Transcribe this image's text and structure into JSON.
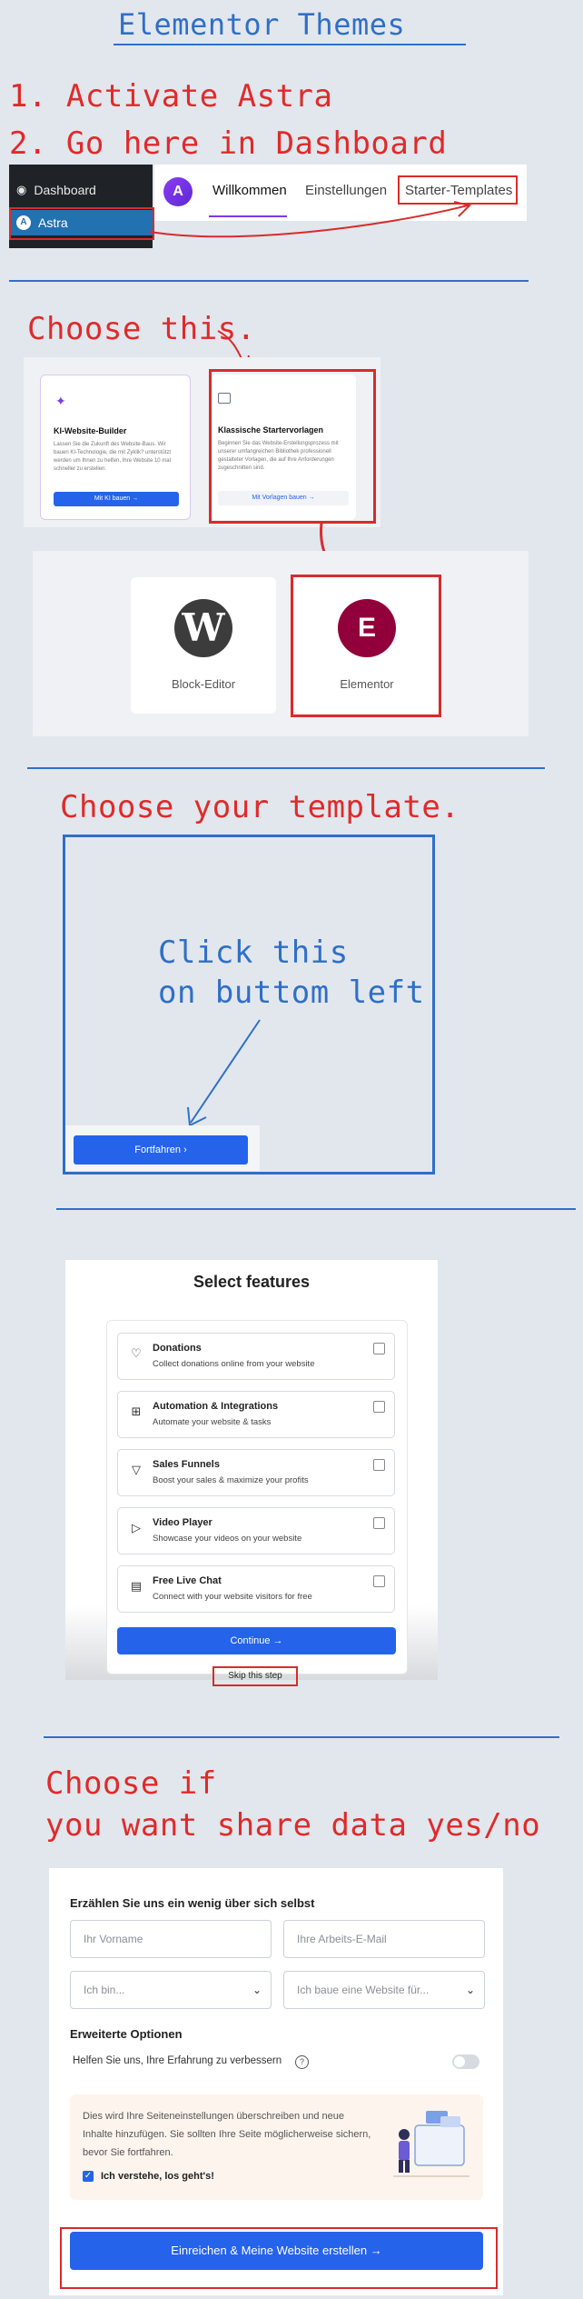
{
  "header": {
    "title": "Elementor Themes",
    "step1": "1. Activate Astra",
    "step2": "2. Go here in Dashboard"
  },
  "wp_admin": {
    "menu_dashboard": "Dashboard",
    "menu_astra": "Astra",
    "tabs": [
      "Willkommen",
      "Einstellungen",
      "Starter-Templates"
    ]
  },
  "section2": {
    "heading": "Choose this.",
    "card_ai": {
      "title": "KI-Website-Builder",
      "text": "Lassen Sie die Zukunft des Website-Baus. Wir bauen KI-Technologie, die mit Zyklik? unterstützt werden um Ihnen zu helfen, Ihre Website 10 mal schneller zu erstellen.",
      "button": "Mit KI bauen →"
    },
    "card_classic": {
      "title": "Klassische Startervorlagen",
      "text": "Beginnen Sie das Website-Erstellungsprozess mit unserer umfangreichen Bibliothek professionell gestalteter Vorlagen, die auf Ihre Anforderungen zugeschnitten sind.",
      "button": "Mit Vorlagen bauen →"
    },
    "builder_block": "Block-Editor",
    "builder_elementor": "Elementor"
  },
  "section3": {
    "heading": "Choose your template.",
    "annotation_line1": "Click this",
    "annotation_line2": "on buttom left",
    "button": "Fortfahren"
  },
  "section4": {
    "title": "Select features",
    "features": [
      {
        "name": "Donations",
        "desc": "Collect donations online from your website",
        "icon": "heart-icon"
      },
      {
        "name": "Automation & Integrations",
        "desc": "Automate your website & tasks",
        "icon": "apps-icon"
      },
      {
        "name": "Sales Funnels",
        "desc": "Boost your sales & maximize your profits",
        "icon": "funnel-icon"
      },
      {
        "name": "Video Player",
        "desc": "Showcase your videos on your website",
        "icon": "play-icon"
      },
      {
        "name": "Free Live Chat",
        "desc": "Connect with your website visitors for free",
        "icon": "chat-icon"
      }
    ],
    "continue": "Continue →",
    "skip": "Skip this step"
  },
  "section5": {
    "heading_line1": "Choose if",
    "heading_line2": "you want share data yes/no",
    "form_title": "Erzählen Sie uns ein wenig über sich selbst",
    "first_name_placeholder": "Ihr Vorname",
    "email_placeholder": "Ihre Arbeits-E-Mail",
    "i_am_placeholder": "Ich bin...",
    "building_placeholder": "Ich baue eine Website für...",
    "advanced": "Erweiterte Optionen",
    "help_label": "Helfen Sie uns, Ihre Erfahrung zu verbessern",
    "warning": "Dies wird Ihre Seiteneinstellungen überschreiben und neue Inhalte hinzufügen. Sie sollten Ihre Seite möglicherweise sichern, bevor Sie fortfahren.",
    "consent": "Ich verstehe, los geht's!",
    "submit": "Einreichen & Meine Website erstellen →"
  },
  "colors": {
    "accent_blue": "#2563eb",
    "annotation_red": "#e02a2a",
    "annotation_blue": "#2f6fc8",
    "elementor": "#92003b"
  }
}
